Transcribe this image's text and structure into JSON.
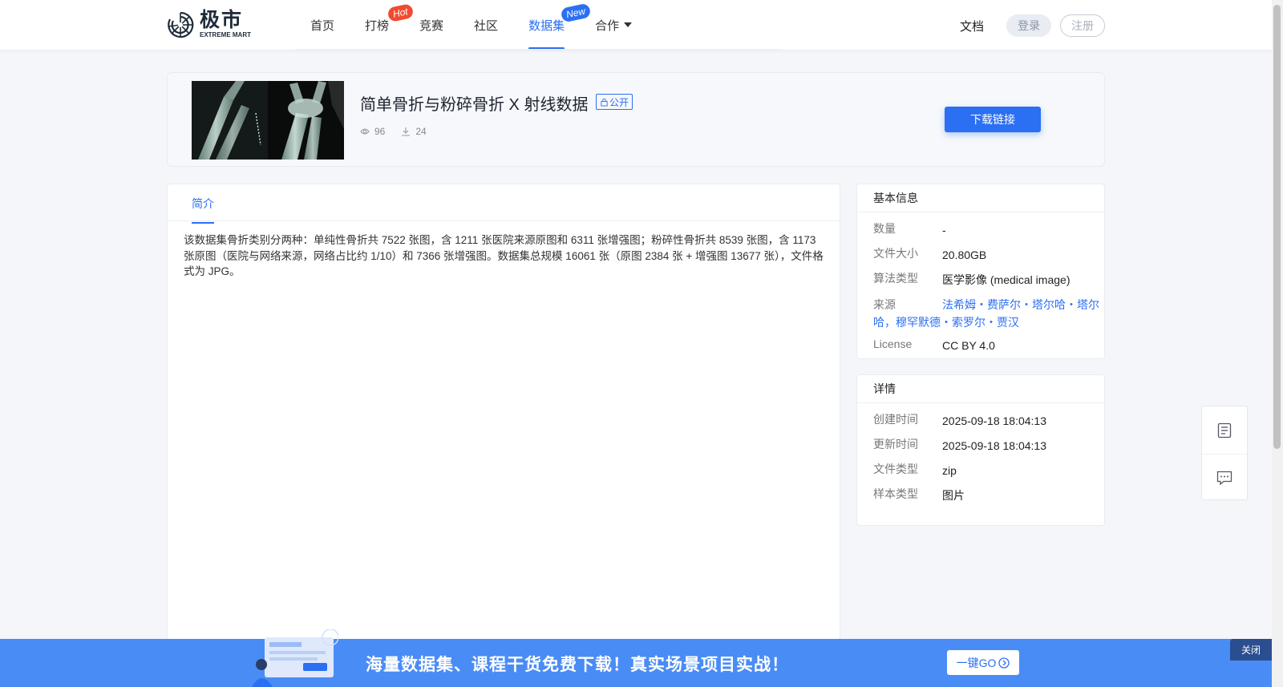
{
  "header": {
    "logo_cn": "极市",
    "logo_en": "EXTREME MART",
    "nav": [
      {
        "label": "首页",
        "badge": ""
      },
      {
        "label": "打榜",
        "badge": "Hot"
      },
      {
        "label": "竞赛",
        "badge": ""
      },
      {
        "label": "社区",
        "badge": ""
      },
      {
        "label": "数据集",
        "badge": "New",
        "active": true
      },
      {
        "label": "合作",
        "badge": "",
        "dropdown": true
      }
    ],
    "docs": "文档",
    "login": "登录",
    "register": "注册"
  },
  "dataset": {
    "title": "简单骨折与粉碎骨折 X 射线数据",
    "visibility": "公开",
    "views": "96",
    "downloads": "24",
    "download_button": "下载链接"
  },
  "tabs": {
    "intro": "简介"
  },
  "intro_text": "该数据集骨折类别分两种：单纯性骨折共 7522 张图，含 1211 张医院来源原图和 6311 张增强图；粉碎性骨折共 8539 张图，含 1173 张原图（医院与网络来源，网络占比约 1/10）和 7366 张增强图。数据集总规模 16061 张（原图 2384 张 + 增强图 13677 张），文件格式为 JPG。",
  "basic_info": {
    "title": "基本信息",
    "rows": [
      {
        "key": "数量",
        "value": "-"
      },
      {
        "key": "文件大小",
        "value": "20.80GB"
      },
      {
        "key": "算法类型",
        "value": "医学影像 (medical image)"
      }
    ],
    "source_key": "来源",
    "source_value": "法希姆・费萨尔・塔尔哈・塔尔哈，穆罕默德・索罗尔・贾汉",
    "license_key": "License",
    "license_value": "CC BY 4.0"
  },
  "details": {
    "title": "详情",
    "rows": [
      {
        "key": "创建时间",
        "value": "2025-09-18 18:04:13"
      },
      {
        "key": "更新时间",
        "value": "2025-09-18 18:04:13"
      },
      {
        "key": "文件类型",
        "value": "zip"
      },
      {
        "key": "样本类型",
        "value": "图片"
      }
    ]
  },
  "float_tools": [
    "document-icon",
    "feedback-icon"
  ],
  "promo": {
    "text": "海量数据集、课程干货免费下载！真实场景项目实战！",
    "go": "一键GO",
    "close": "关闭"
  },
  "colors": {
    "accent": "#2b6ff3",
    "hot": "#f24a2f",
    "promo_bg": "#4a8cf5"
  }
}
